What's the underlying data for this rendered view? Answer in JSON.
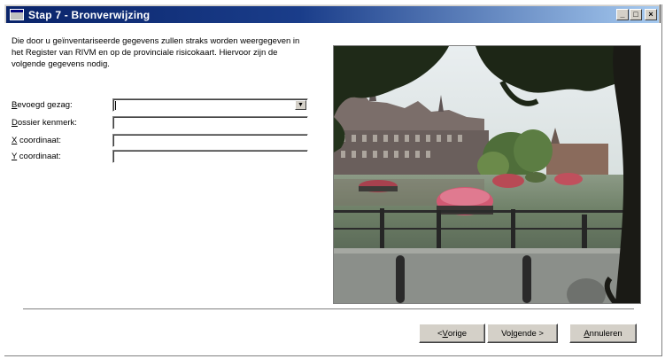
{
  "window": {
    "title": "Stap 7 - Bronverwijzing",
    "minimize_glyph": "_",
    "maximize_glyph": "□",
    "close_glyph": "×"
  },
  "intro": {
    "text": "Die door u geïnventariseerde gegevens zullen straks worden weergegeven in het Register van RIVM en op de provinciale risicokaart. Hiervoor zijn de volgende gegevens nodig."
  },
  "form": {
    "fields": [
      {
        "label_accel": "B",
        "label_rest": "evoegd gezag:",
        "value": "",
        "type": "select",
        "dropdown_glyph": "▼"
      },
      {
        "label_accel": "D",
        "label_rest": "ossier kenmerk:",
        "value": "",
        "type": "text"
      },
      {
        "label_accel": "X",
        "label_rest": " coordinaat:",
        "value": "",
        "type": "text"
      },
      {
        "label_accel": "Y",
        "label_rest": " coordinaat:",
        "value": "",
        "type": "text"
      }
    ]
  },
  "buttons": {
    "prev_prefix": "< ",
    "prev_accel": "V",
    "prev_rest": "orige",
    "next_prefix": "Vo",
    "next_accel": "l",
    "next_rest": "gende >",
    "cancel_accel": "A",
    "cancel_rest": "nnuleren"
  },
  "icons": {
    "app": "window-app-icon",
    "minimize": "minimize-icon",
    "maximize": "maximize-icon",
    "close": "close-icon",
    "dropdown": "chevron-down-icon"
  }
}
